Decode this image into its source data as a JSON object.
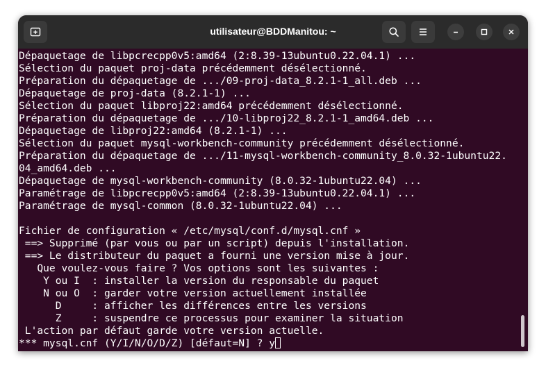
{
  "window": {
    "title": "utilisateur@BDDManitou: ~"
  },
  "terminal": {
    "lines": [
      "Dépaquetage de libpcrecpp0v5:amd64 (2:8.39-13ubuntu0.22.04.1) ...",
      "Sélection du paquet proj-data précédemment désélectionné.",
      "Préparation du dépaquetage de .../09-proj-data_8.2.1-1_all.deb ...",
      "Dépaquetage de proj-data (8.2.1-1) ...",
      "Sélection du paquet libproj22:amd64 précédemment désélectionné.",
      "Préparation du dépaquetage de .../10-libproj22_8.2.1-1_amd64.deb ...",
      "Dépaquetage de libproj22:amd64 (8.2.1-1) ...",
      "Sélection du paquet mysql-workbench-community précédemment désélectionné.",
      "Préparation du dépaquetage de .../11-mysql-workbench-community_8.0.32-1ubuntu22.",
      "04_amd64.deb ...",
      "Dépaquetage de mysql-workbench-community (8.0.32-1ubuntu22.04) ...",
      "Paramétrage de libpcrecpp0v5:amd64 (2:8.39-13ubuntu0.22.04.1) ...",
      "Paramétrage de mysql-common (8.0.32-1ubuntu22.04) ...",
      "",
      "Fichier de configuration « /etc/mysql/conf.d/mysql.cnf »",
      " ==> Supprimé (par vous ou par un script) depuis l'installation.",
      " ==> Le distributeur du paquet a fourni une version mise à jour.",
      "   Que voulez-vous faire ? Vos options sont les suivantes :",
      "    Y ou I  : installer la version du responsable du paquet",
      "    N ou O  : garder votre version actuellement installée",
      "      D     : afficher les différences entre les versions",
      "      Z     : suspendre ce processus pour examiner la situation",
      " L'action par défaut garde votre version actuelle."
    ],
    "prompt_line": "*** mysql.cnf (Y/I/N/O/D/Z) [défaut=N] ? ",
    "input_value": "y"
  },
  "icons": {
    "new_tab": "new-tab-icon",
    "search": "search-icon",
    "menu": "hamburger-menu-icon",
    "minimize": "minimize-icon",
    "maximize": "maximize-icon",
    "close": "close-icon"
  }
}
